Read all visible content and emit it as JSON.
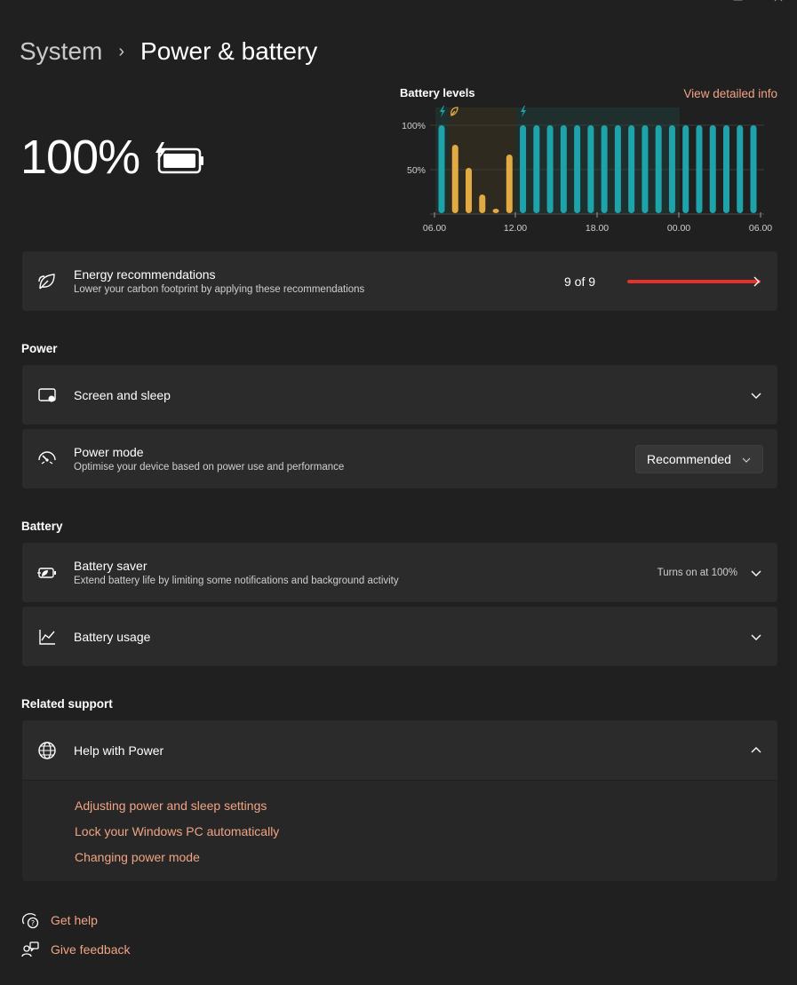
{
  "breadcrumb": {
    "parent": "System",
    "separator": "›",
    "current": "Power & battery"
  },
  "battery": {
    "percent": "100%",
    "charging": true,
    "level": 1.0
  },
  "chart_data": {
    "type": "bar",
    "title": "Battery levels",
    "link": "View detailed info",
    "ytick_labels": [
      "100%",
      "50%"
    ],
    "ylim": [
      0,
      100
    ],
    "xtick_labels": [
      "06.00",
      "12.00",
      "18.00",
      "00.00",
      "06.00"
    ],
    "grid": true,
    "series": [
      {
        "color": "#1fa3ab",
        "state": "charging",
        "values": [
          100,
          null,
          null,
          null,
          null,
          null,
          100,
          100,
          100,
          100,
          100,
          100,
          100,
          100,
          100,
          100,
          100,
          100,
          100,
          100,
          100,
          100,
          100,
          100
        ]
      },
      {
        "color": "#e2aa42",
        "state": "battery",
        "values": [
          null,
          78,
          52,
          22,
          6,
          67,
          null,
          null,
          null,
          null,
          null,
          null,
          null,
          null,
          null,
          null,
          null,
          null,
          null,
          null,
          null,
          null,
          null,
          null
        ]
      }
    ],
    "state_colors": {
      "charging_band": "#1f2f2d",
      "battery_band": "#2e2a20",
      "charging": "#1fa3ab",
      "battery": "#e2aa42"
    }
  },
  "energy": {
    "title": "Energy recommendations",
    "subtitle": "Lower your carbon footprint by applying these recommendations",
    "count": "9 of 9",
    "progress": 1.0,
    "progress_color": "#e5312b"
  },
  "power_section": {
    "label": "Power",
    "screen_sleep": {
      "title": "Screen and sleep"
    },
    "power_mode": {
      "title": "Power mode",
      "subtitle": "Optimise your device based on power use and performance",
      "selected": "Recommended"
    }
  },
  "battery_section": {
    "label": "Battery",
    "saver": {
      "title": "Battery saver",
      "subtitle": "Extend battery life by limiting some notifications and background activity",
      "status": "Turns on at 100%"
    },
    "usage": {
      "title": "Battery usage"
    }
  },
  "related": {
    "label": "Related support",
    "help": {
      "title": "Help with Power",
      "links": [
        "Adjusting power and sleep settings",
        "Lock your Windows PC automatically",
        "Changing power mode"
      ]
    }
  },
  "footer": {
    "get_help": "Get help",
    "give_feedback": "Give feedback"
  },
  "colors": {
    "accent_link": "#f0a483",
    "background": "#202020",
    "card": "#2b2b2b"
  },
  "icons": [
    "leaf-icon",
    "screen-sleep-icon",
    "power-mode-icon",
    "battery-saver-icon",
    "battery-usage-icon",
    "globe-icon",
    "get-help-icon",
    "feedback-icon"
  ]
}
